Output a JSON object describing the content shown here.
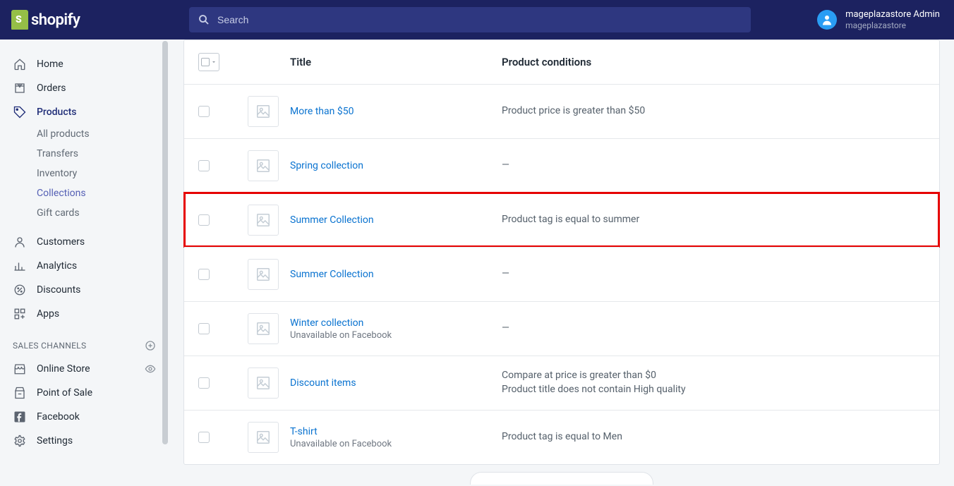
{
  "brand": {
    "name": "shopify"
  },
  "search": {
    "placeholder": "Search"
  },
  "user": {
    "name": "mageplazastore Admin",
    "store": "mageplazastore"
  },
  "sidebar": {
    "home": "Home",
    "orders": "Orders",
    "products": "Products",
    "sub": {
      "all": "All products",
      "transfers": "Transfers",
      "inventory": "Inventory",
      "collections": "Collections",
      "giftcards": "Gift cards"
    },
    "customers": "Customers",
    "analytics": "Analytics",
    "discounts": "Discounts",
    "apps": "Apps",
    "channels_title": "SALES CHANNELS",
    "online_store": "Online Store",
    "pos": "Point of Sale",
    "facebook": "Facebook",
    "settings": "Settings"
  },
  "table": {
    "headers": {
      "title": "Title",
      "conditions": "Product conditions"
    },
    "rows": [
      {
        "title": "More than $50",
        "subtitle": "",
        "condition_lines": [
          "Product price is greater than $50"
        ],
        "highlight": false
      },
      {
        "title": "Spring collection",
        "subtitle": "",
        "condition_lines": [
          "—"
        ],
        "highlight": false
      },
      {
        "title": "Summer Collection",
        "subtitle": "",
        "condition_lines": [
          "Product tag is equal to summer"
        ],
        "highlight": true
      },
      {
        "title": "Summer Collection",
        "subtitle": "",
        "condition_lines": [
          "—"
        ],
        "highlight": false
      },
      {
        "title": "Winter collection",
        "subtitle": "Unavailable on Facebook",
        "condition_lines": [
          "—"
        ],
        "highlight": false
      },
      {
        "title": "Discount items",
        "subtitle": "",
        "condition_lines": [
          "Compare at price is greater than $0",
          "Product title does not contain High quality"
        ],
        "highlight": false
      },
      {
        "title": "T-shirt",
        "subtitle": "Unavailable on Facebook",
        "condition_lines": [
          "Product tag is equal to Men"
        ],
        "highlight": false
      }
    ]
  }
}
